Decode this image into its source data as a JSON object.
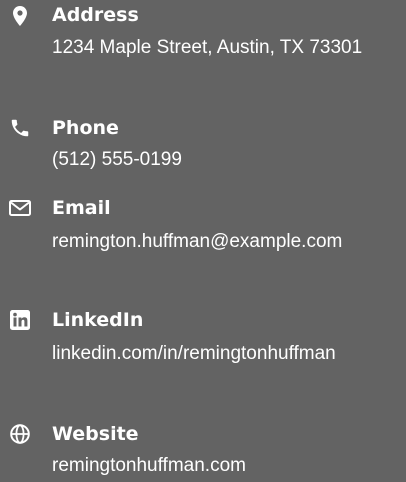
{
  "contacts": {
    "address": {
      "icon": "map-marker-icon",
      "label": "Address",
      "value": "1234 Maple Street, Austin, TX 73301"
    },
    "phone": {
      "icon": "phone-icon",
      "label": "Phone",
      "value": "(512) 555-0199"
    },
    "email": {
      "icon": "envelope-icon",
      "label": "Email",
      "value": "remington.huffman@example.com"
    },
    "linkedin": {
      "icon": "linkedin-icon",
      "label": "LinkedIn",
      "value": "linkedin.com/in/remingtonhuffman"
    },
    "website": {
      "icon": "globe-icon",
      "label": "Website",
      "value": "remingtonhuffman.com"
    }
  },
  "colors": {
    "background": "#636363",
    "text": "#ffffff"
  }
}
